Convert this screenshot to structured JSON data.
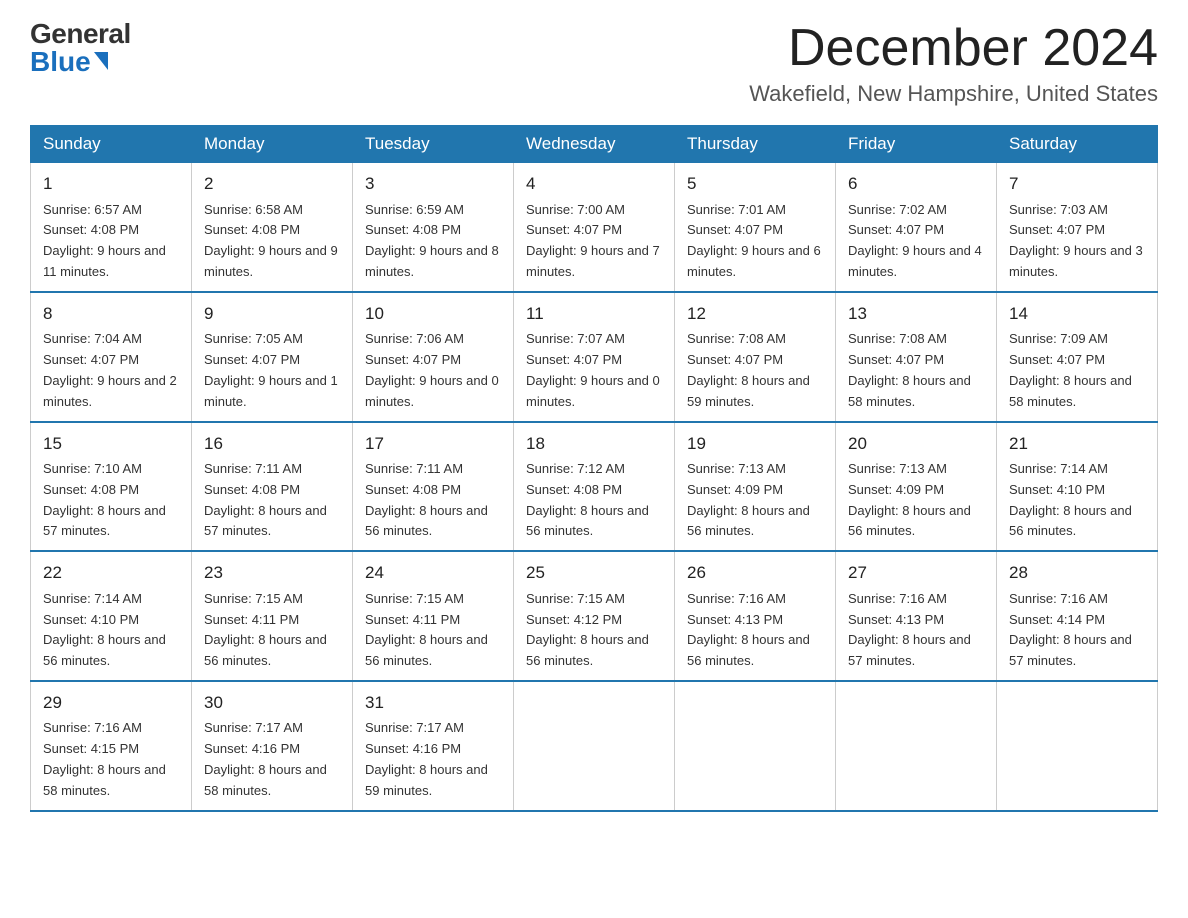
{
  "logo": {
    "general": "General",
    "blue": "Blue"
  },
  "header": {
    "month": "December 2024",
    "location": "Wakefield, New Hampshire, United States"
  },
  "weekdays": [
    "Sunday",
    "Monday",
    "Tuesday",
    "Wednesday",
    "Thursday",
    "Friday",
    "Saturday"
  ],
  "weeks": [
    [
      {
        "day": 1,
        "sunrise": "6:57 AM",
        "sunset": "4:08 PM",
        "daylight": "9 hours and 11 minutes."
      },
      {
        "day": 2,
        "sunrise": "6:58 AM",
        "sunset": "4:08 PM",
        "daylight": "9 hours and 9 minutes."
      },
      {
        "day": 3,
        "sunrise": "6:59 AM",
        "sunset": "4:08 PM",
        "daylight": "9 hours and 8 minutes."
      },
      {
        "day": 4,
        "sunrise": "7:00 AM",
        "sunset": "4:07 PM",
        "daylight": "9 hours and 7 minutes."
      },
      {
        "day": 5,
        "sunrise": "7:01 AM",
        "sunset": "4:07 PM",
        "daylight": "9 hours and 6 minutes."
      },
      {
        "day": 6,
        "sunrise": "7:02 AM",
        "sunset": "4:07 PM",
        "daylight": "9 hours and 4 minutes."
      },
      {
        "day": 7,
        "sunrise": "7:03 AM",
        "sunset": "4:07 PM",
        "daylight": "9 hours and 3 minutes."
      }
    ],
    [
      {
        "day": 8,
        "sunrise": "7:04 AM",
        "sunset": "4:07 PM",
        "daylight": "9 hours and 2 minutes."
      },
      {
        "day": 9,
        "sunrise": "7:05 AM",
        "sunset": "4:07 PM",
        "daylight": "9 hours and 1 minute."
      },
      {
        "day": 10,
        "sunrise": "7:06 AM",
        "sunset": "4:07 PM",
        "daylight": "9 hours and 0 minutes."
      },
      {
        "day": 11,
        "sunrise": "7:07 AM",
        "sunset": "4:07 PM",
        "daylight": "9 hours and 0 minutes."
      },
      {
        "day": 12,
        "sunrise": "7:08 AM",
        "sunset": "4:07 PM",
        "daylight": "8 hours and 59 minutes."
      },
      {
        "day": 13,
        "sunrise": "7:08 AM",
        "sunset": "4:07 PM",
        "daylight": "8 hours and 58 minutes."
      },
      {
        "day": 14,
        "sunrise": "7:09 AM",
        "sunset": "4:07 PM",
        "daylight": "8 hours and 58 minutes."
      }
    ],
    [
      {
        "day": 15,
        "sunrise": "7:10 AM",
        "sunset": "4:08 PM",
        "daylight": "8 hours and 57 minutes."
      },
      {
        "day": 16,
        "sunrise": "7:11 AM",
        "sunset": "4:08 PM",
        "daylight": "8 hours and 57 minutes."
      },
      {
        "day": 17,
        "sunrise": "7:11 AM",
        "sunset": "4:08 PM",
        "daylight": "8 hours and 56 minutes."
      },
      {
        "day": 18,
        "sunrise": "7:12 AM",
        "sunset": "4:08 PM",
        "daylight": "8 hours and 56 minutes."
      },
      {
        "day": 19,
        "sunrise": "7:13 AM",
        "sunset": "4:09 PM",
        "daylight": "8 hours and 56 minutes."
      },
      {
        "day": 20,
        "sunrise": "7:13 AM",
        "sunset": "4:09 PM",
        "daylight": "8 hours and 56 minutes."
      },
      {
        "day": 21,
        "sunrise": "7:14 AM",
        "sunset": "4:10 PM",
        "daylight": "8 hours and 56 minutes."
      }
    ],
    [
      {
        "day": 22,
        "sunrise": "7:14 AM",
        "sunset": "4:10 PM",
        "daylight": "8 hours and 56 minutes."
      },
      {
        "day": 23,
        "sunrise": "7:15 AM",
        "sunset": "4:11 PM",
        "daylight": "8 hours and 56 minutes."
      },
      {
        "day": 24,
        "sunrise": "7:15 AM",
        "sunset": "4:11 PM",
        "daylight": "8 hours and 56 minutes."
      },
      {
        "day": 25,
        "sunrise": "7:15 AM",
        "sunset": "4:12 PM",
        "daylight": "8 hours and 56 minutes."
      },
      {
        "day": 26,
        "sunrise": "7:16 AM",
        "sunset": "4:13 PM",
        "daylight": "8 hours and 56 minutes."
      },
      {
        "day": 27,
        "sunrise": "7:16 AM",
        "sunset": "4:13 PM",
        "daylight": "8 hours and 57 minutes."
      },
      {
        "day": 28,
        "sunrise": "7:16 AM",
        "sunset": "4:14 PM",
        "daylight": "8 hours and 57 minutes."
      }
    ],
    [
      {
        "day": 29,
        "sunrise": "7:16 AM",
        "sunset": "4:15 PM",
        "daylight": "8 hours and 58 minutes."
      },
      {
        "day": 30,
        "sunrise": "7:17 AM",
        "sunset": "4:16 PM",
        "daylight": "8 hours and 58 minutes."
      },
      {
        "day": 31,
        "sunrise": "7:17 AM",
        "sunset": "4:16 PM",
        "daylight": "8 hours and 59 minutes."
      },
      null,
      null,
      null,
      null
    ]
  ],
  "labels": {
    "sunrise": "Sunrise:",
    "sunset": "Sunset:",
    "daylight": "Daylight:"
  }
}
